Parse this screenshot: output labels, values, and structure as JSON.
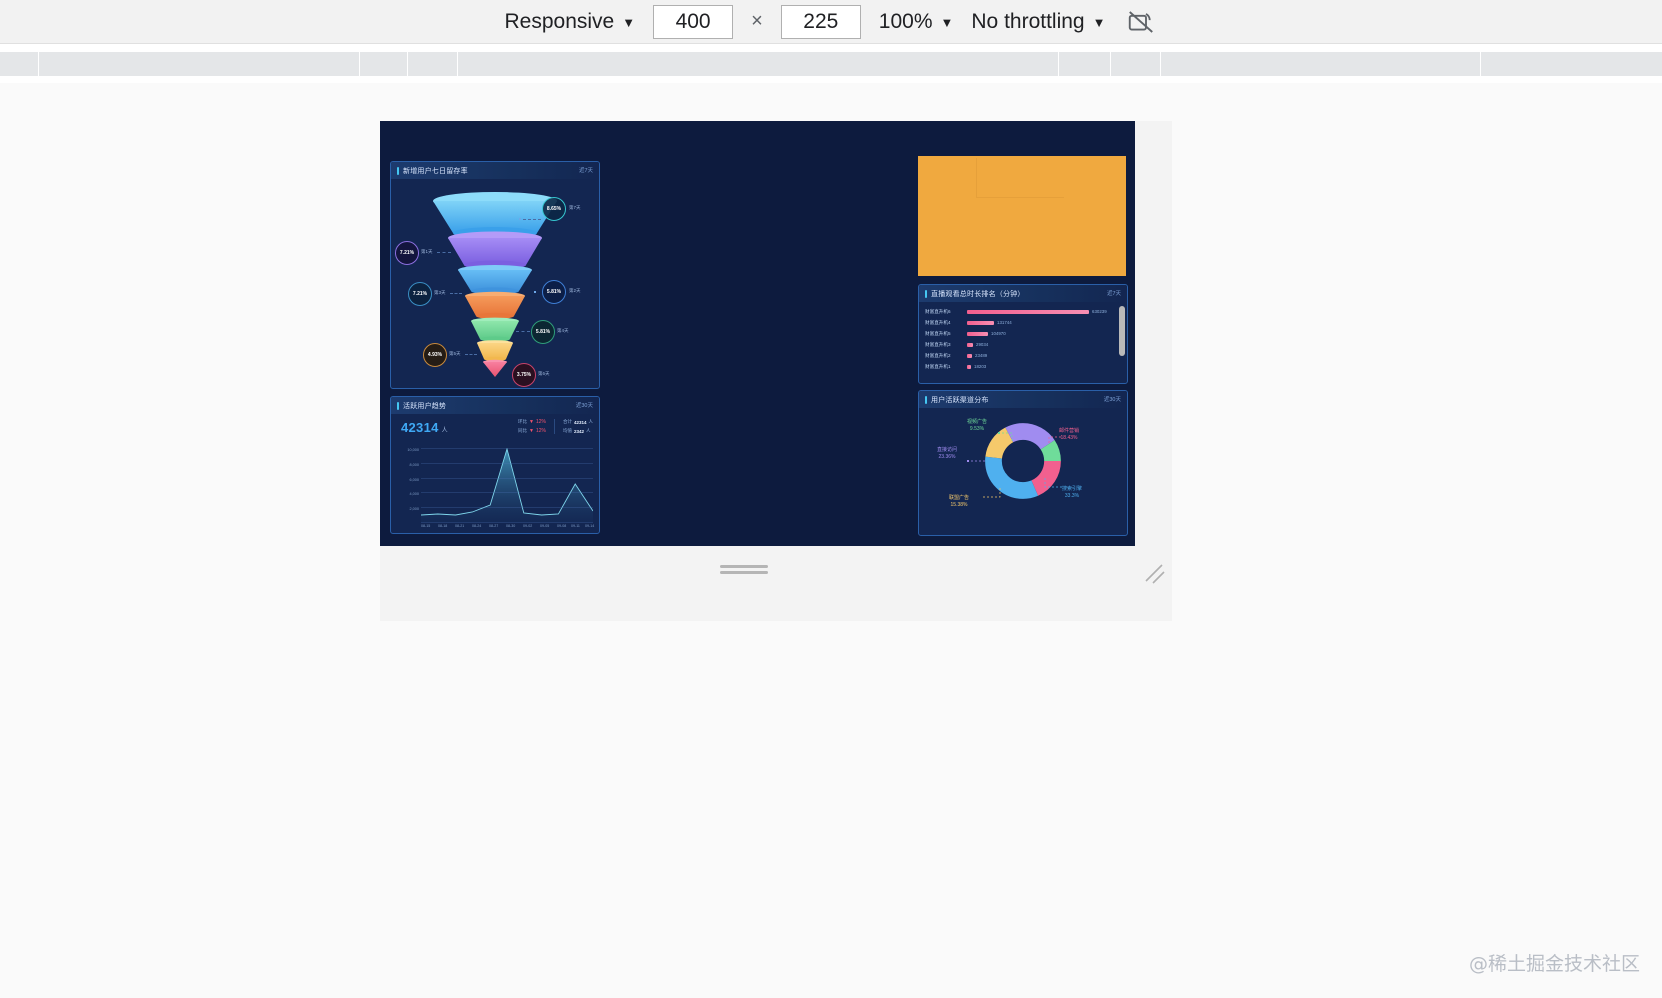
{
  "devtools": {
    "device_preset": "Responsive",
    "width": "400",
    "height": "225",
    "multiply": "×",
    "zoom": "100%",
    "throttling": "No throttling",
    "rotate_icon": "rotate-device-icon",
    "caret": "▼"
  },
  "dashboard": {
    "funnel_panel": {
      "title": "新增用户七日留存率",
      "range": "近7天",
      "chart_data": {
        "type": "funnel",
        "title": "新增用户七日留存率",
        "categories": [
          "第1天",
          "第2天",
          "第3天",
          "第4天",
          "第5天",
          "第6天",
          "第7天"
        ],
        "values": [
          8.65,
          7.21,
          7.21,
          5.81,
          5.81,
          4.93,
          3.75
        ],
        "value_labels": [
          "8.65%",
          "7.21%",
          "7.21%",
          "5.81%",
          "5.81%",
          "4.93%",
          "3.75%"
        ],
        "colors": [
          "#4fc3f7",
          "#9b7bf0",
          "#4aa8ef",
          "#f08344",
          "#6fdc9a",
          "#f5c council",
          "#f0628c"
        ]
      },
      "stages": [
        {
          "label": "第7天",
          "value": "8.65%",
          "color": "#36c7d0",
          "side": "right"
        },
        {
          "label": "第1天",
          "value": "7.21%",
          "color": "#8c6fe0",
          "side": "left"
        },
        {
          "label": "第2天",
          "value": "5.81%",
          "color": "#3f7fd6",
          "side": "right"
        },
        {
          "label": "第3天",
          "value": "7.21%",
          "color": "#3a8fc4",
          "side": "left"
        },
        {
          "label": "第4天",
          "value": "5.81%",
          "color": "#2f9e7a",
          "side": "right"
        },
        {
          "label": "第5天",
          "value": "4.93%",
          "color": "#c98a3c",
          "side": "left"
        },
        {
          "label": "第6天",
          "value": "3.75%",
          "color": "#c9436a",
          "side": "right"
        }
      ]
    },
    "line_panel": {
      "title": "活跃用户趋势",
      "range": "近30天",
      "headline_value": "42314",
      "headline_unit": "人",
      "stats": [
        {
          "label": "环比",
          "arrow": "▼",
          "value": "12%"
        },
        {
          "label": "同比",
          "arrow": "▼",
          "value": "12%"
        },
        {
          "label": "合计",
          "value": "42314",
          "unit": "人"
        },
        {
          "label": "均值",
          "value": "2342",
          "unit": "人"
        }
      ],
      "chart_data": {
        "type": "area",
        "title": "活跃用户趋势",
        "ylabel": "",
        "xlabel": "",
        "ylim": [
          0,
          10000
        ],
        "yticks": [
          "10,000",
          "8,000",
          "6,000",
          "4,000",
          "2,000"
        ],
        "x": [
          "08-15",
          "08-18",
          "08-21",
          "08-24",
          "08-27",
          "08-30",
          "09-02",
          "09-05",
          "09-08",
          "09-11",
          "09-14"
        ],
        "values": [
          900,
          1100,
          1000,
          1300,
          2300,
          9800,
          1200,
          900,
          1100,
          5200,
          1500
        ],
        "series_color": "#4fb6d8",
        "grid": true
      }
    },
    "rank_panel": {
      "title": "直播观看总时长排名（分钟）",
      "range": "近7天",
      "chart_data": {
        "type": "bar",
        "orientation": "horizontal",
        "title": "直播观看总时长排名（分钟）",
        "categories": [
          "财富直升机6",
          "财富直升机4",
          "财富直升机5",
          "财富直升机3",
          "财富直升机2",
          "财富直升机1"
        ],
        "values": [
          630239,
          131744,
          104970,
          29034,
          23489,
          18203
        ],
        "value_labels": [
          "630239",
          "131744",
          "104970",
          "29034",
          "23489",
          "18203"
        ],
        "bar_color": "#f2608f"
      }
    },
    "donut_panel": {
      "title": "用户活跃渠道分布",
      "range": "近30天",
      "chart_data": {
        "type": "pie",
        "title": "用户活跃渠道分布",
        "categories": [
          "视频广告",
          "邮件营销",
          "搜索引擎",
          "联盟广告",
          "直接访问"
        ],
        "values": [
          9.53,
          18.43,
          33.3,
          15.38,
          23.36
        ],
        "value_labels": [
          "9.53%",
          "18.43%",
          "33.3%",
          "15.38%",
          "23.36%"
        ],
        "colors": [
          "#6fdc9a",
          "#f2608f",
          "#4fb0ef",
          "#f5c96b",
          "#a08cf0"
        ],
        "legend": "labels-outside",
        "donut": true
      },
      "slices": [
        {
          "name": "视频广告",
          "pct": "9.53%",
          "color": "#6fdc9a"
        },
        {
          "name": "邮件营销",
          "pct": "18.43%",
          "color": "#f2608f"
        },
        {
          "name": "搜索引擎",
          "pct": "33.3%",
          "color": "#4fb0ef"
        },
        {
          "name": "联盟广告",
          "pct": "15.38%",
          "color": "#f5c96b"
        },
        {
          "name": "直接访问",
          "pct": "23.36%",
          "color": "#a08cf0"
        }
      ]
    }
  },
  "watermark": "@稀土掘金技术社区"
}
